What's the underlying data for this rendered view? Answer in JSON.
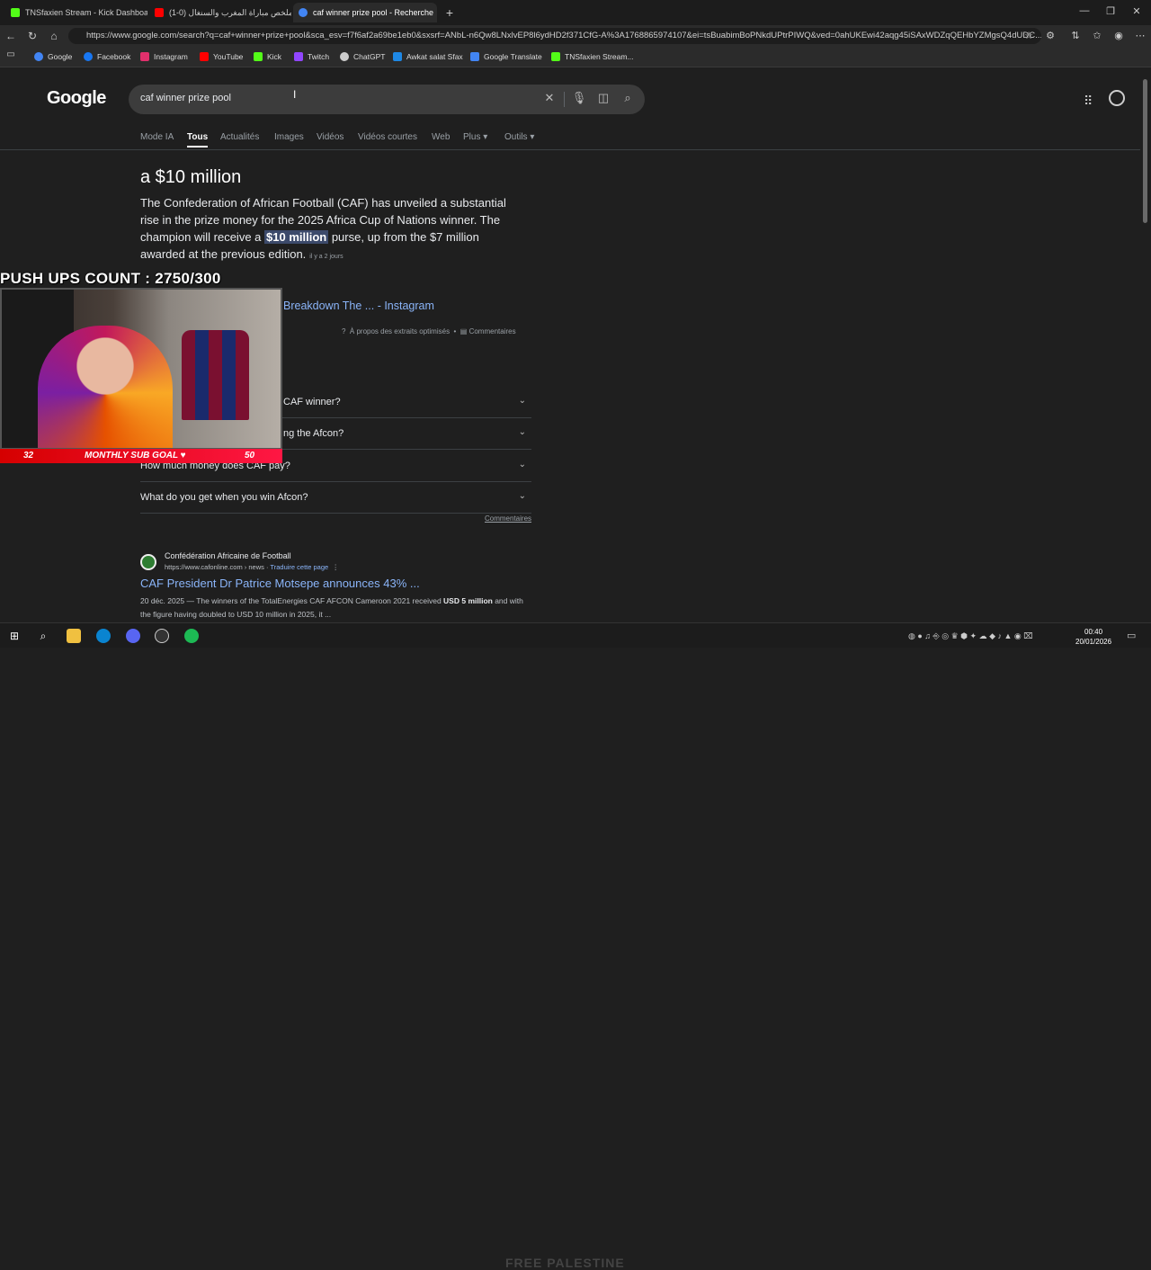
{
  "tabs": [
    {
      "label": "TNSfaxien Stream - Kick Dashboa",
      "color": "#53fc18"
    },
    {
      "label": "ملخص مباراة المغرب والسنغال (0-1)",
      "color": "#ff0000"
    },
    {
      "label": "caf winner prize pool - Recherche",
      "color": "#4285f4"
    }
  ],
  "url": "https://www.google.com/search?q=caf+winner+prize+pool&sca_esv=f7f6af2a69be1eb0&sxsrf=ANbL-n6Qw8LNxlvEP8l6ydHD2f371CfG-A%3A1768865974107&ei=tsBuabimBoPNkdUPtrPIWQ&ved=0ahUKEwi42aqg45iSAxWDZqQEHbYZMgsQ4dUDC...",
  "bookmarks": [
    "Google",
    "Facebook",
    "Instagram",
    "YouTube",
    "Kick",
    "Twitch",
    "ChatGPT",
    "Awkat salat Sfax",
    "Google Translate",
    "TNSfaxien Stream..."
  ],
  "google": {
    "logo": "Google",
    "query": "caf winner prize pool",
    "nav_tabs": [
      "Mode IA",
      "Tous",
      "Actualités",
      "Images",
      "Vidéos",
      "Vidéos courtes",
      "Web",
      "Plus ▾",
      "Outils ▾"
    ]
  },
  "featured": {
    "answer": "a $10 million",
    "desc_pre": "The Confederation of African Football (CAF) has unveiled a substantial rise in the prize money for the 2025 Africa Cup of Nations winner. The champion will receive a ",
    "desc_hl": "$10 million",
    "desc_post": " purse, up from the $7 million awarded at the previous edition.",
    "date": "il y a 2 jours",
    "source_title": "Breakdown The ... - Instagram",
    "about": "À propos des extraits optimisés",
    "comments": "Commentaires"
  },
  "faq": [
    "CAF winner?",
    "ng the Afcon?",
    "How much money does CAF pay?",
    "What do you get when you win Afcon?"
  ],
  "faq_comments": "Commentaires",
  "result": {
    "site": "Confédération Africaine de Football",
    "url": "https://www.cafonline.com › news",
    "translate": "Traduire cette page",
    "title": "CAF President Dr Patrice Motsepe announces 43% ...",
    "snippet_pre": "20 déc. 2025 — The winners of the TotalEnergies CAF AFCON Cameroon 2021 received ",
    "snippet_b": "USD 5 million",
    "snippet_post": " and with the figure having doubled to USD 10 million in 2025, it ..."
  },
  "stream": {
    "pushups": "PUSH UPS COUNT : 2750/300",
    "sub_current": "32",
    "sub_label": "MONTHLY SUB GOAL ♥",
    "sub_target": "50"
  },
  "taskbar": {
    "time": "00:40",
    "date": "20/01/2026",
    "overlay": "FREE PALESTINE"
  }
}
